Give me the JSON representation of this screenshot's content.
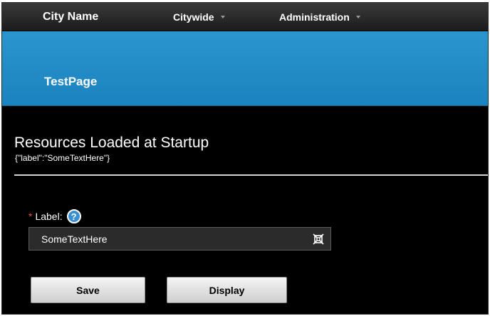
{
  "nav": {
    "brand": "City Name",
    "menus": [
      {
        "label": "Citywide",
        "icon": "caret-down-icon"
      },
      {
        "label": "Administration",
        "icon": "caret-down-icon"
      }
    ]
  },
  "page": {
    "title": "TestPage"
  },
  "content": {
    "heading": "Resources Loaded at Startup",
    "subheading": "{\"label\":\"SomeTextHere\"}"
  },
  "form": {
    "required_marker": "*",
    "label": "Label:",
    "help_glyph": "?",
    "label_value": "SomeTextHere"
  },
  "actions": {
    "save_label": "Save",
    "display_label": "Display"
  },
  "colors": {
    "header_blue": "#1f8bc6",
    "required_red": "#e74c3c",
    "background": "#000000"
  }
}
